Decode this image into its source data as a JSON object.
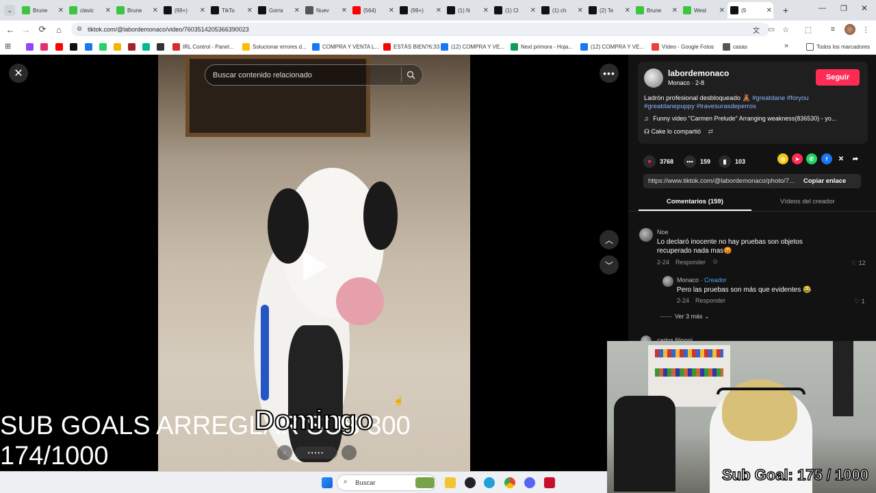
{
  "browser": {
    "tabs": [
      {
        "title": "Brune",
        "color": "#3fc43f"
      },
      {
        "title": "clavic",
        "color": "#3fc43f"
      },
      {
        "title": "Brune",
        "color": "#3fc43f"
      },
      {
        "title": "(99+)",
        "color": "#111111"
      },
      {
        "title": "TikTo",
        "color": "#111111"
      },
      {
        "title": "Gorra",
        "color": "#111111"
      },
      {
        "title": "Nuev",
        "color": "#555555"
      },
      {
        "title": "(564)",
        "color": "#ff0000"
      },
      {
        "title": "(99+)",
        "color": "#111111"
      },
      {
        "title": "(1) N",
        "color": "#111111"
      },
      {
        "title": "(1) Cl",
        "color": "#111111"
      },
      {
        "title": "(1) ch",
        "color": "#111111"
      },
      {
        "title": "(2) Te",
        "color": "#111111"
      },
      {
        "title": "Brune",
        "color": "#3fc43f"
      },
      {
        "title": "West",
        "color": "#3fc43f"
      },
      {
        "title": "(9",
        "color": "#111111"
      }
    ],
    "new_tab": "+",
    "url": "tiktok.com/@labordemonaco/video/7603514205366390023",
    "bookmarks": [
      {
        "label": "",
        "color": "#9146ff"
      },
      {
        "label": "",
        "color": "#e1306c"
      },
      {
        "label": "",
        "color": "#ff0000"
      },
      {
        "label": "",
        "color": "#111111"
      },
      {
        "label": "",
        "color": "#1877f2"
      },
      {
        "label": "",
        "color": "#25d366"
      },
      {
        "label": "",
        "color": "#f4b400"
      },
      {
        "label": "",
        "color": "#a0262a"
      },
      {
        "label": "",
        "color": "#00b894"
      },
      {
        "label": "",
        "color": "#333333"
      },
      {
        "label": "IRL Control - Panel...",
        "color": "#d32f2f"
      },
      {
        "label": "Solucionar errores d...",
        "color": "#fbbc04"
      },
      {
        "label": "COMPRA Y VENTA L...",
        "color": "#1877f2"
      },
      {
        "label": "ESTÁS BIEN?6:33",
        "color": "#ff0000"
      },
      {
        "label": "(12) COMPRA Y VE...",
        "color": "#1877f2"
      },
      {
        "label": "Next primora - Hoja...",
        "color": "#0f9d58"
      },
      {
        "label": "(12) COMPRA Y VE...",
        "color": "#1877f2"
      },
      {
        "label": "Vídeo - Google Fotos",
        "color": "#ea4335"
      },
      {
        "label": "casas",
        "color": "#555555"
      }
    ],
    "bookmarks_more": "»",
    "all_bookmarks": "Todos los marcadores"
  },
  "video": {
    "search_placeholder": "Buscar contenido relacionado",
    "domingo_caption": "Domingo"
  },
  "stream_overlay": {
    "line1": "SUB GOALS ARREGLAR SUS 300",
    "line2": "174/1000",
    "webcam_goal": "Sub Goal:  175 / 1000"
  },
  "panel": {
    "username": "labordemonaco",
    "display_name": "Monaco",
    "date": "2-8",
    "follow": "Seguir",
    "caption_text": "Ladrón profesional desbloqueado 🧸",
    "caption_tags_1": "#greatdane #foryou",
    "caption_tags_2": "#greatdanepuppy #travesurasdeperros",
    "music": "Funny video \"Carmen Prelude\" Arranging weakness(836530) - yo...",
    "shared_by": "Cake lo compartió",
    "likes": "3768",
    "comments_count": "159",
    "saves": "103",
    "link": "https://www.tiktok.com/@labordemonaco/photo/7...",
    "copy_link": "Copiar enlace",
    "tab_comments": "Comentarios (159)",
    "tab_creator": "Vídeos del creador",
    "comments": [
      {
        "author": "Noe",
        "text1": "Lo declaró inocente no hay pruebas son objetos",
        "text2": "recuperado nada mas😡",
        "date": "2-24",
        "reply": "Responder",
        "likes": "12"
      },
      {
        "author": "Monaco",
        "tag": "Creador",
        "text1": "Pero las pruebas son más que evidentes 😂",
        "date": "2-24",
        "reply": "Responder",
        "likes": "1"
      }
    ],
    "view_more": "Ver 3 más",
    "next_author": "carlos filiponi"
  },
  "taskbar": {
    "search": "Buscar"
  }
}
